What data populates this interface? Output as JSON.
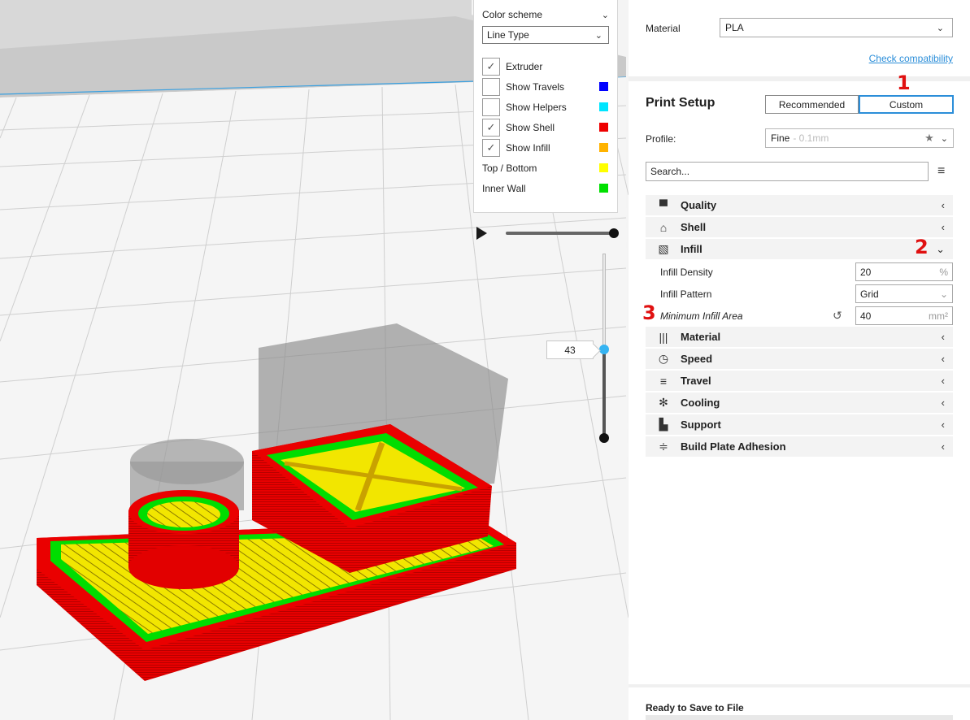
{
  "layer_view": {
    "color_scheme_label": "Color scheme",
    "line_type": "Line Type",
    "legend": [
      {
        "label": "Extruder",
        "checkbox": true,
        "checked": true,
        "color": null
      },
      {
        "label": "Show Travels",
        "checkbox": true,
        "checked": false,
        "color": "#0000ff"
      },
      {
        "label": "Show Helpers",
        "checkbox": true,
        "checked": false,
        "color": "#00e5ff"
      },
      {
        "label": "Show Shell",
        "checkbox": true,
        "checked": true,
        "color": "#ee0000"
      },
      {
        "label": "Show Infill",
        "checkbox": true,
        "checked": true,
        "color": "#ffb300"
      },
      {
        "label": "Top / Bottom",
        "checkbox": false,
        "checked": false,
        "color": "#ffff00"
      },
      {
        "label": "Inner Wall",
        "checkbox": false,
        "checked": false,
        "color": "#00e000"
      }
    ],
    "layer_number": "43"
  },
  "material": {
    "label": "Material",
    "value": "PLA",
    "check_link": "Check compatibility"
  },
  "print_setup": {
    "title": "Print Setup",
    "mode_tabs": [
      "Recommended",
      "Custom"
    ],
    "active_mode": "Custom",
    "profile_label": "Profile:",
    "profile_name": "Fine",
    "profile_desc": " - 0.1mm",
    "search_placeholder": "Search..."
  },
  "categories_top": [
    {
      "name": "Quality",
      "icon": "quality-icon",
      "glyph": "▀",
      "arrow": "‹"
    },
    {
      "name": "Shell",
      "icon": "shell-icon",
      "glyph": "⌂",
      "arrow": "‹"
    },
    {
      "name": "Infill",
      "icon": "infill-icon",
      "glyph": "▧",
      "arrow": "⌄"
    }
  ],
  "infill_settings": [
    {
      "name": "Infill Density",
      "value": "20",
      "unit": "%",
      "italic": false,
      "reset": false
    },
    {
      "name": "Infill Pattern",
      "value": "Grid",
      "unit": "⌄",
      "italic": false,
      "reset": false
    },
    {
      "name": "Minimum Infill Area",
      "value": "40",
      "unit": "mm²",
      "italic": true,
      "reset": true
    }
  ],
  "categories_bottom": [
    {
      "name": "Material",
      "icon": "material-icon",
      "glyph": "|||",
      "arrow": "‹"
    },
    {
      "name": "Speed",
      "icon": "speed-icon",
      "glyph": "◷",
      "arrow": "‹"
    },
    {
      "name": "Travel",
      "icon": "travel-icon",
      "glyph": "≡",
      "arrow": "‹"
    },
    {
      "name": "Cooling",
      "icon": "cooling-icon",
      "glyph": "✻",
      "arrow": "‹"
    },
    {
      "name": "Support",
      "icon": "support-icon",
      "glyph": "▙",
      "arrow": "‹"
    },
    {
      "name": "Build Plate Adhesion",
      "icon": "adhesion-icon",
      "glyph": "≑",
      "arrow": "‹"
    }
  ],
  "annotations": {
    "mark1": "1",
    "mark2": "2",
    "mark3": "3"
  },
  "status": {
    "ready": "Ready to Save to File"
  },
  "colors": {
    "accent": "#2b8ed9",
    "annotation": "#e01010"
  }
}
